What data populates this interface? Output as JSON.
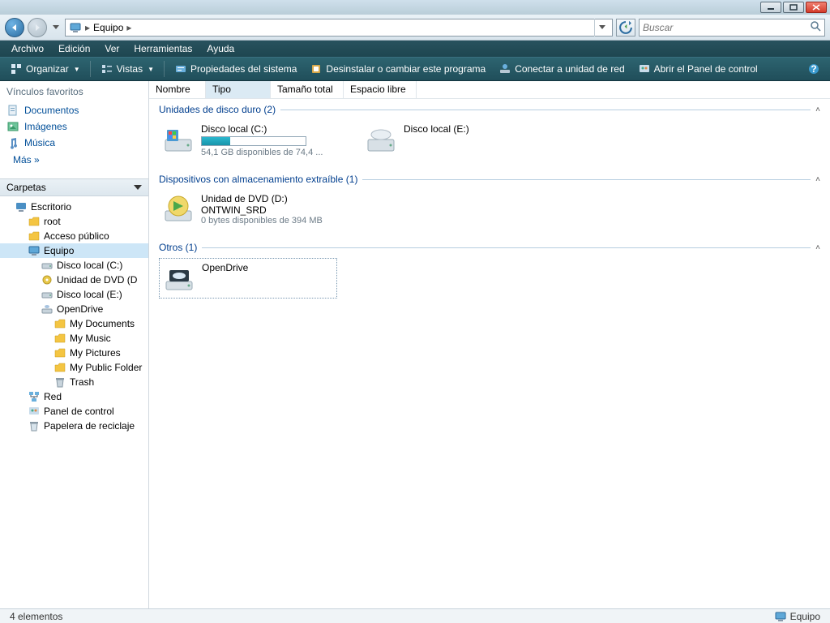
{
  "titlebar": {},
  "nav": {
    "crumb1": "Equipo",
    "search_placeholder": "Buscar"
  },
  "menu": {
    "archivo": "Archivo",
    "edicion": "Edición",
    "ver": "Ver",
    "herramientas": "Herramientas",
    "ayuda": "Ayuda"
  },
  "cmd": {
    "organizar": "Organizar",
    "vistas": "Vistas",
    "propiedades": "Propiedades del sistema",
    "desinstalar": "Desinstalar o cambiar este programa",
    "conectar": "Conectar a unidad de red",
    "panel": "Abrir el Panel de control"
  },
  "sidebar": {
    "fav_header": "Vínculos favoritos",
    "documentos": "Documentos",
    "imagenes": "Imágenes",
    "musica": "Música",
    "mas": "Más »",
    "carpetas_header": "Carpetas",
    "tree": {
      "escritorio": "Escritorio",
      "root": "root",
      "acceso_publico": "Acceso público",
      "equipo": "Equipo",
      "disco_c": "Disco local (C:)",
      "dvd_d": "Unidad de DVD (D",
      "disco_e": "Disco local (E:)",
      "opendrive": "OpenDrive",
      "mydocs": "My Documents",
      "mymusic": "My Music",
      "mypics": "My Pictures",
      "mypublic": "My Public Folder",
      "trash": "Trash",
      "red": "Red",
      "panel": "Panel de control",
      "papelera": "Papelera de reciclaje"
    }
  },
  "columns": {
    "nombre": "Nombre",
    "tipo": "Tipo",
    "tamano": "Tamaño total",
    "espacio": "Espacio libre"
  },
  "groups": {
    "hdd": {
      "title": "Unidades de disco duro (2)"
    },
    "removable": {
      "title": "Dispositivos con almacenamiento extraíble (1)"
    },
    "otros": {
      "title": "Otros (1)"
    }
  },
  "drives": {
    "c": {
      "label": "Disco local (C:)",
      "meta": "54,1 GB disponibles de 74,4 ...",
      "fillpct": 27
    },
    "e": {
      "label": "Disco local (E:)"
    },
    "dvd": {
      "label": "Unidad de DVD (D:)",
      "sub": "ONTWIN_SRD",
      "meta": "0 bytes disponibles de 394 MB"
    },
    "opendrive": {
      "label": "OpenDrive"
    }
  },
  "status": {
    "left": "4 elementos",
    "right": "Equipo"
  }
}
